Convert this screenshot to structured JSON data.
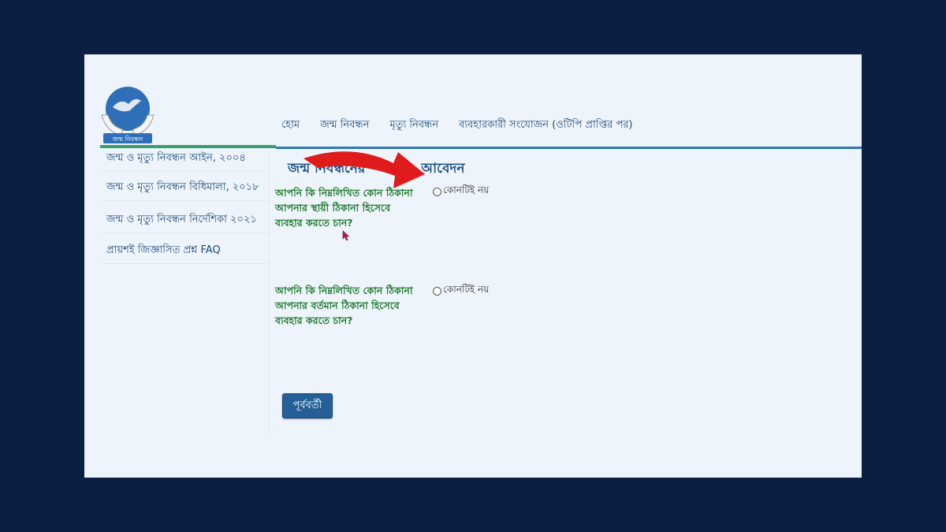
{
  "logo": {
    "caption": "জন্ম নিবন্ধন"
  },
  "nav": {
    "items": [
      "হোম",
      "জন্ম নিবন্ধন",
      "মৃত্যু নিবন্ধন",
      "ব্যবহারকারী সংযোজন (ওটিপি প্রাপ্তির পর)"
    ]
  },
  "sidebar": {
    "items": [
      "জন্ম ও মৃত্যু নিবন্ধন আইন, ২০০৪",
      "জন্ম ও মৃত্যু নিবন্ধন বিধিমালা, ২০১৮",
      "জন্ম ও মৃত্যু নিবন্ধন নির্দেশিকা ২০২১",
      "প্রায়শই জিজ্ঞাসিত প্রশ্ন FAQ"
    ]
  },
  "main": {
    "heading": "জন্ম নিবন্ধনের            আবেদন",
    "question1": "আপনি কি নিম্নলিখিত কোন ঠিকানা আপনার স্থায়ী ঠিকানা হিসেবে ব্যবহার করতে চান?",
    "question1_option": "কোনটিই নয়",
    "question2": "আপনি কি নিম্নলিখিত কোন ঠিকানা আপনার বর্তমান ঠিকানা হিসেবে ব্যবহার করতে চান?",
    "question2_option": "কোনটিই নয়",
    "prev_button": "পূর্ববর্তী"
  },
  "colors": {
    "frame_bg": "#0b1f45",
    "page_bg": "#eef4fb",
    "question_text": "#1f7a2e",
    "heading_text": "#1d5184",
    "button_bg": "#245f97",
    "arrow": "#e01b1b"
  }
}
